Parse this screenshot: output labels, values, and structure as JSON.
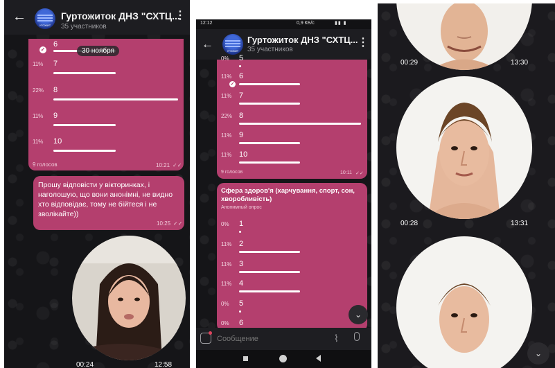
{
  "chat": {
    "title": "Гуртожиток ДНЗ \"СХТЦ...",
    "title2": "Гуртожиток ДНЗ \"СХТЦ...",
    "members": "35 участников",
    "members2": "35 участников",
    "avatar_text": "УГОЖИТ"
  },
  "panel1": {
    "date": "30 ноября",
    "options": [
      {
        "pct": "",
        "label": "6",
        "fraction": 0.11
      },
      {
        "pct": "11%",
        "label": "7",
        "fraction": 0.11
      },
      {
        "pct": "22%",
        "label": "8",
        "fraction": 0.22
      },
      {
        "pct": "11%",
        "label": "9",
        "fraction": 0.11
      },
      {
        "pct": "11%",
        "label": "10",
        "fraction": 0.11
      }
    ],
    "votes": "9 голосов",
    "poll_time": "10:21",
    "message": "Прошу відповісти у вікторинках, і наголошую, що вони анонімні, не видно хто відповідає, тому не бійтеся і не зволікайте))",
    "message_time": "10:25",
    "video_duration": "00:24",
    "video_time": "12:58"
  },
  "panel2": {
    "status_time": "12:12",
    "status_right": "0,9 КБ/с",
    "poll1": {
      "options": [
        {
          "pct": "0%",
          "label": "5",
          "fraction": 0.0
        },
        {
          "pct": "11%",
          "label": "6",
          "fraction": 0.11
        },
        {
          "pct": "11%",
          "label": "7",
          "fraction": 0.11
        },
        {
          "pct": "22%",
          "label": "8",
          "fraction": 0.22
        },
        {
          "pct": "11%",
          "label": "9",
          "fraction": 0.11
        },
        {
          "pct": "11%",
          "label": "10",
          "fraction": 0.11
        }
      ],
      "votes": "9 голосов",
      "time": "10:11"
    },
    "poll2": {
      "question": "Сфера здоров'я (харчування, спорт, сон, хворобливість)",
      "type": "Анонимный опрос",
      "options": [
        {
          "pct": "0%",
          "label": "1",
          "fraction": 0.0
        },
        {
          "pct": "11%",
          "label": "2",
          "fraction": 0.11
        },
        {
          "pct": "11%",
          "label": "3",
          "fraction": 0.11
        },
        {
          "pct": "11%",
          "label": "4",
          "fraction": 0.11
        },
        {
          "pct": "0%",
          "label": "5",
          "fraction": 0.0
        },
        {
          "pct": "0%",
          "label": "6",
          "fraction": 0.0
        }
      ]
    },
    "input_placeholder": "Сообщение"
  },
  "panel3": {
    "videos": [
      {
        "duration": "00:29",
        "time": "13:30"
      },
      {
        "duration": "00:28",
        "time": "13:31"
      }
    ]
  },
  "icons": {
    "back": "arrow-left-icon",
    "menu": "more-vertical-icon",
    "emoji": "sticker-icon",
    "attach": "paperclip-icon",
    "mic": "microphone-icon",
    "scroll": "chevron-down-icon"
  },
  "colors": {
    "bubble": "#b43f6e",
    "background": "#151518",
    "header": "#1d1d21"
  }
}
